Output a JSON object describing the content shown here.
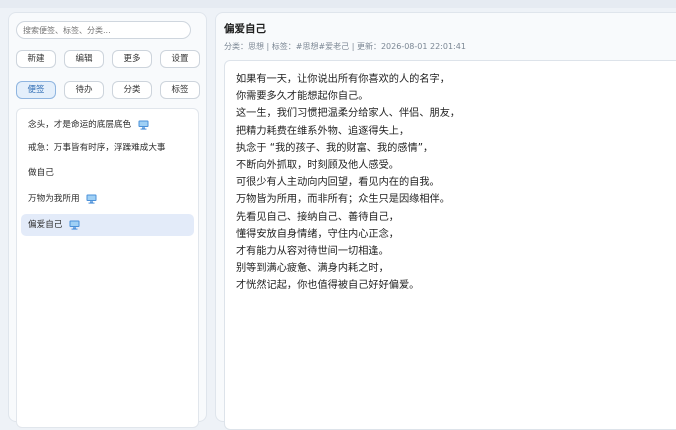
{
  "search": {
    "placeholder": "搜索便签、标签、分类..."
  },
  "toolbar": {
    "new_label": "新建",
    "edit_label": "编辑",
    "more_label": "更多",
    "settings_label": "设置"
  },
  "tabs": [
    {
      "label": "便签",
      "active": true
    },
    {
      "label": "待办",
      "active": false
    },
    {
      "label": "分类",
      "active": false
    },
    {
      "label": "标签",
      "active": false
    }
  ],
  "notes": [
    {
      "title": "念头，才是命运的底层底色",
      "icon": "computer-icon"
    },
    {
      "title": "戒急：万事皆有时序，浮躁难成大事",
      "icon": ""
    },
    {
      "title": "做自己",
      "icon": ""
    },
    {
      "title": "万物为我所用",
      "icon": "computer-icon"
    },
    {
      "title": "偏爱自己",
      "icon": "computer-icon",
      "selected": true
    }
  ],
  "detail": {
    "title": "偏爱自己",
    "meta": "分类：思想 | 标签：#思想#爱老己 | 更新：2026-08-01 22:01:41",
    "lines": [
      "如果有一天，让你说出所有你喜欢的人的名字，",
      "你需要多久才能想起你自己。",
      "这一生，我们习惯把温柔分给家人、伴侣、朋友，",
      "把精力耗费在维系外物、追逐得失上，",
      "执念于 “我的孩子、我的财富、我的感情”，",
      "不断向外抓取，时刻顾及他人感受。",
      "可很少有人主动向内回望，看见内在的自我。",
      "万物皆为所用，而非所有；众生只是因缘相伴。",
      "先看见自己、接纳自己、善待自己，",
      "懂得安放自身情绪，守住内心正念，",
      "才有能力从容对待世间一切相逢。",
      "别等到满心疲惫、满身内耗之时，",
      "才恍然记起，你也值得被自己好好偏爱。"
    ]
  },
  "colors": {
    "selected_bg": "#e3ebf9",
    "accent": "#2f6db5",
    "meta": "#7b8794"
  }
}
